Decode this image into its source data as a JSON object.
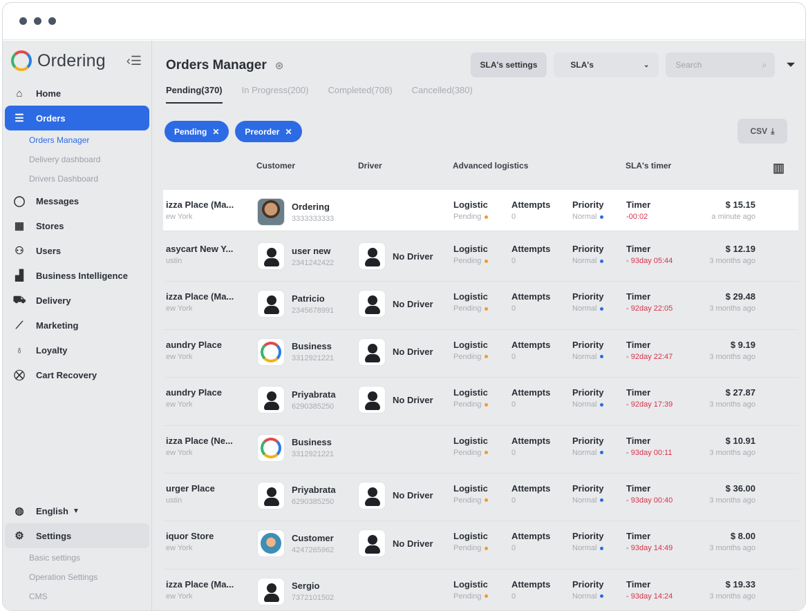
{
  "window": {
    "controls": [
      "dot",
      "dot",
      "dot"
    ]
  },
  "sidebar": {
    "logo": "Ordering",
    "items": [
      {
        "label": "Home",
        "icon": "home-icon"
      },
      {
        "label": "Orders",
        "icon": "list-icon",
        "active": true
      },
      {
        "label": "Messages",
        "icon": "chat-icon"
      },
      {
        "label": "Stores",
        "icon": "store-icon"
      },
      {
        "label": "Users",
        "icon": "users-icon"
      },
      {
        "label": "Business Intelligence",
        "icon": "bar-chart-icon"
      },
      {
        "label": "Delivery",
        "icon": "truck-icon"
      },
      {
        "label": "Marketing",
        "icon": "trend-icon"
      },
      {
        "label": "Loyalty",
        "icon": "award-icon"
      },
      {
        "label": "Cart Recovery",
        "icon": "cart-icon"
      }
    ],
    "orders_sub": [
      "Orders Manager",
      "Delivery dashboard",
      "Drivers Dashboard"
    ],
    "language": "English",
    "settings": "Settings",
    "settings_sub": [
      "Basic settings",
      "Operation Settings",
      "CMS"
    ]
  },
  "header": {
    "title": "Orders Manager",
    "sla_settings": "SLA's settings",
    "sla_select": "SLA's",
    "search_placeholder": "Search",
    "csv": "CSV"
  },
  "tabs": [
    "Pending(370)",
    "In Progress(200)",
    "Completed(708)",
    "Cancelled(380)"
  ],
  "chips": [
    "Pending",
    "Preorder"
  ],
  "columns": {
    "customer": "Customer",
    "driver": "Driver",
    "logistics": "Advanced logistics",
    "sla": "SLA's timer"
  },
  "row_labels": {
    "logistic": "Logistic",
    "attempts": "Attempts",
    "priority": "Priority",
    "timer": "Timer"
  },
  "orders": [
    {
      "business": "izza Place (Ma...",
      "city": "ew York",
      "customer": "Ordering",
      "phone": "3333333333",
      "avatar": "photo",
      "driver": "",
      "logistic": "Pending",
      "attempts": "0",
      "priority": "Normal",
      "timer": "-00:02",
      "price": "$ 15.15",
      "time": "a minute ago",
      "highlight": true
    },
    {
      "business": "asycart New Y...",
      "city": "ustin",
      "customer": "user new",
      "phone": "2341242422",
      "avatar": "person",
      "driver": "No Driver",
      "logistic": "Pending",
      "attempts": "0",
      "priority": "Normal",
      "timer": "- 93day 05:44",
      "price": "$ 12.19",
      "time": "3 months ago"
    },
    {
      "business": "izza Place (Ma...",
      "city": "ew York",
      "customer": "Patricio",
      "phone": "2345678991",
      "avatar": "person",
      "driver": "No Driver",
      "logistic": "Pending",
      "attempts": "0",
      "priority": "Normal",
      "timer": "- 92day 22:05",
      "price": "$ 29.48",
      "time": "3 months ago"
    },
    {
      "business": "aundry Place",
      "city": "ew York",
      "customer": "Business",
      "phone": "3312921221",
      "avatar": "ring",
      "driver": "No Driver",
      "logistic": "Pending",
      "attempts": "0",
      "priority": "Normal",
      "timer": "- 92day 22:47",
      "price": "$ 9.19",
      "time": "3 months ago"
    },
    {
      "business": "aundry Place",
      "city": "ew York",
      "customer": "Priyabrata",
      "phone": "6290385250",
      "avatar": "person",
      "driver": "No Driver",
      "logistic": "Pending",
      "attempts": "0",
      "priority": "Normal",
      "timer": "- 92day 17:39",
      "price": "$ 27.87",
      "time": "3 months ago"
    },
    {
      "business": "izza Place (Ne...",
      "city": "ew York",
      "customer": "Business",
      "phone": "3312921221",
      "avatar": "ring",
      "driver": "",
      "logistic": "Pending",
      "attempts": "0",
      "priority": "Normal",
      "timer": "- 93day 00:11",
      "price": "$ 10.91",
      "time": "3 months ago"
    },
    {
      "business": "urger Place",
      "city": "ustin",
      "customer": "Priyabrata",
      "phone": "6290385250",
      "avatar": "person",
      "driver": "No Driver",
      "logistic": "Pending",
      "attempts": "0",
      "priority": "Normal",
      "timer": "- 93day 00:40",
      "price": "$ 36.00",
      "time": "3 months ago"
    },
    {
      "business": "iquor Store",
      "city": "ew York",
      "customer": "Customer",
      "phone": "4247265962",
      "avatar": "cust",
      "driver": "No Driver",
      "logistic": "Pending",
      "attempts": "0",
      "priority": "Normal",
      "timer": "- 93day 14:49",
      "price": "$ 8.00",
      "time": "3 months ago"
    },
    {
      "business": "izza Place (Ma...",
      "city": "ew York",
      "customer": "Sergio",
      "phone": "7372101502",
      "avatar": "person",
      "driver": "",
      "logistic": "Pending",
      "attempts": "0",
      "priority": "Normal",
      "timer": "- 93day 14:24",
      "price": "$ 19.33",
      "time": "3 months ago"
    }
  ]
}
